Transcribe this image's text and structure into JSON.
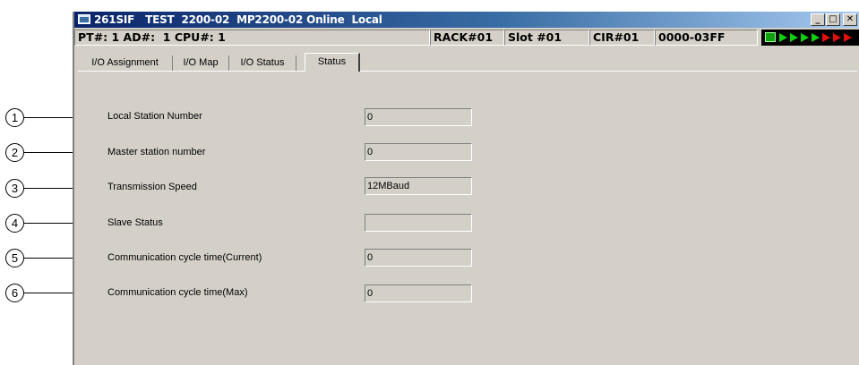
{
  "window": {
    "title": "261SIF   TEST  2200-02  MP2200-02 Online  Local",
    "minimize_label": "_",
    "restore_label": "□",
    "close_label": "✕"
  },
  "statusbar": {
    "pt_ad_cpu": "PT#: 1 AD#:  1 CPU#: 1",
    "rack": "RACK#01",
    "slot": "Slot #01",
    "cir": "CIR#01",
    "range": "0000-03FF"
  },
  "tabs": [
    {
      "label": "I/O Assignment"
    },
    {
      "label": "I/O Map"
    },
    {
      "label": "I/O Status"
    },
    {
      "label": "Status",
      "active": true
    }
  ],
  "rows": [
    {
      "number": "1",
      "label": "Local Station Number",
      "value": "0"
    },
    {
      "number": "2",
      "label": "Master station number",
      "value": "0"
    },
    {
      "number": "3",
      "label": "Transmission Speed",
      "value": "12MBaud"
    },
    {
      "number": "4",
      "label": "Slave Status",
      "value": ""
    },
    {
      "number": "5",
      "label": "Communication cycle time(Current)",
      "value": "0"
    },
    {
      "number": "6",
      "label": "Communication cycle time(Max)",
      "value": "0"
    }
  ],
  "colors": {
    "titlebar_start": "#0a246a",
    "panel": "#d4d0c8",
    "led_green": "#10d010",
    "led_red": "#e01010"
  },
  "icons": {
    "app": "application-window-icon",
    "led": "communication-led-indicator-icon"
  }
}
